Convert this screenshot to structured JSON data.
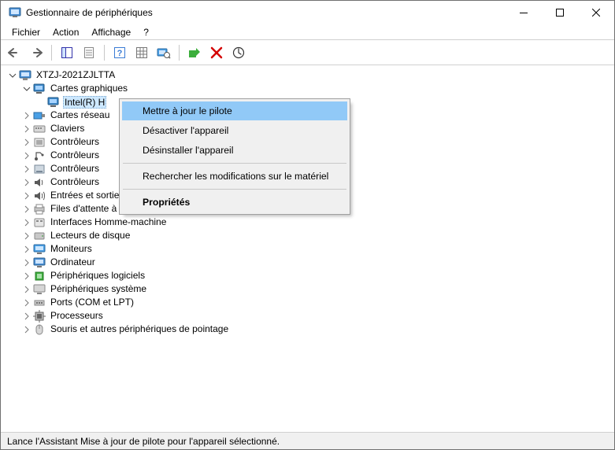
{
  "window": {
    "title": "Gestionnaire de périphériques"
  },
  "menubar": {
    "items": [
      "Fichier",
      "Action",
      "Affichage",
      "?"
    ]
  },
  "tree": {
    "root": "XTZJ-2021ZJLTTA",
    "display_adapters": {
      "label": "Cartes graphiques",
      "child": "Intel(R) H"
    },
    "categories": [
      "Cartes réseau",
      "Claviers",
      "Contrôleurs",
      "Contrôleurs",
      "Contrôleurs",
      "Contrôleurs",
      "Entrées et sorties audio",
      "Files d'attente à l'impression :",
      "Interfaces Homme-machine",
      "Lecteurs de disque",
      "Moniteurs",
      "Ordinateur",
      "Périphériques logiciels",
      "Périphériques système",
      "Ports (COM et LPT)",
      "Processeurs",
      "Souris et autres périphériques de pointage"
    ]
  },
  "context_menu": {
    "items": [
      "Mettre à jour le pilote",
      "Désactiver l'appareil",
      "Désinstaller l'appareil",
      "Rechercher les modifications sur le matériel",
      "Propriétés"
    ]
  },
  "statusbar": {
    "text": "Lance l'Assistant Mise à jour de pilote pour l'appareil sélectionné."
  }
}
